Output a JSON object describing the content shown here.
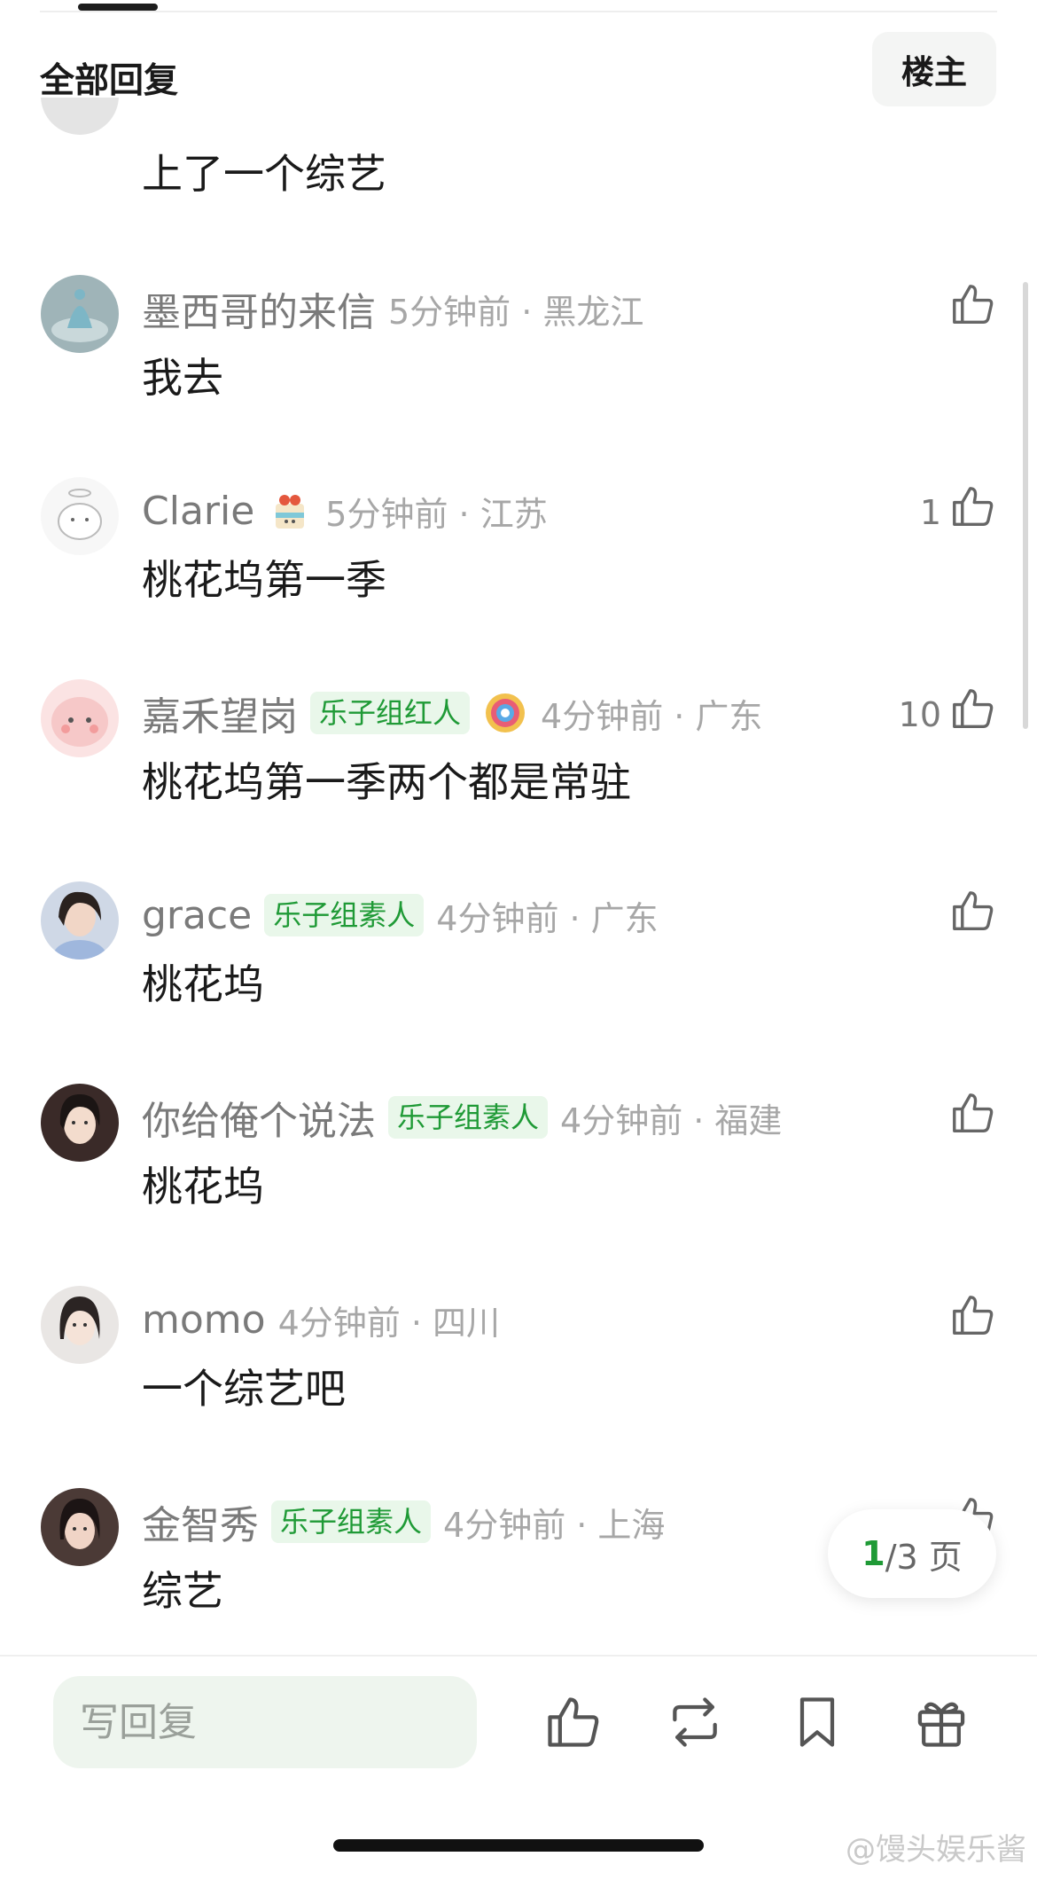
{
  "header": {
    "title": "全部回复",
    "filter_label": "楼主"
  },
  "partial_comment": {
    "text": "上了一个综艺"
  },
  "comments": [
    {
      "username": "墨西哥的来信",
      "badge": "",
      "medal": "",
      "time_location": "5分钟前 · 黑龙江",
      "text": "我去",
      "likes": "",
      "avatar": "avatar-blue-figure"
    },
    {
      "username": "Clarie",
      "badge": "",
      "medal": "cake-medal-icon",
      "time_location": "5分钟前 · 江苏",
      "text": "桃花坞第一季",
      "likes": "1",
      "avatar": "avatar-cat-angel"
    },
    {
      "username": "嘉禾望岗",
      "badge": "乐子组红人",
      "medal": "rainbow-medal-icon",
      "time_location": "4分钟前 · 广东",
      "text": "桃花坞第一季两个都是常驻",
      "likes": "10",
      "avatar": "avatar-pink-blob"
    },
    {
      "username": "grace",
      "badge": "乐子组素人",
      "medal": "",
      "time_location": "4分钟前 · 广东",
      "text": "桃花坞",
      "likes": "",
      "avatar": "avatar-woman-photo"
    },
    {
      "username": "你给俺个说法",
      "badge": "乐子组素人",
      "medal": "",
      "time_location": "4分钟前 · 福建",
      "text": "桃花坞",
      "likes": "",
      "avatar": "avatar-woman-photo"
    },
    {
      "username": "momo",
      "badge": "",
      "medal": "",
      "time_location": "4分钟前 · 四川",
      "text": "一个综艺吧",
      "likes": "",
      "avatar": "avatar-woman-photo"
    },
    {
      "username": "金智秀",
      "badge": "乐子组素人",
      "medal": "",
      "time_location": "4分钟前 · 上海",
      "text": "综艺",
      "likes": "",
      "avatar": "avatar-woman-photo"
    }
  ],
  "pagination": {
    "current": "1",
    "rest": "/3 页"
  },
  "bottom_bar": {
    "reply_placeholder": "写回复",
    "actions": [
      "thumbs-up-icon",
      "repost-icon",
      "bookmark-icon",
      "gift-icon"
    ]
  },
  "watermark": "@馒头娱乐酱",
  "colors": {
    "accent_green": "#1f9a36",
    "badge_bg": "#e9f7ea",
    "muted_text": "#a7a7a7"
  }
}
